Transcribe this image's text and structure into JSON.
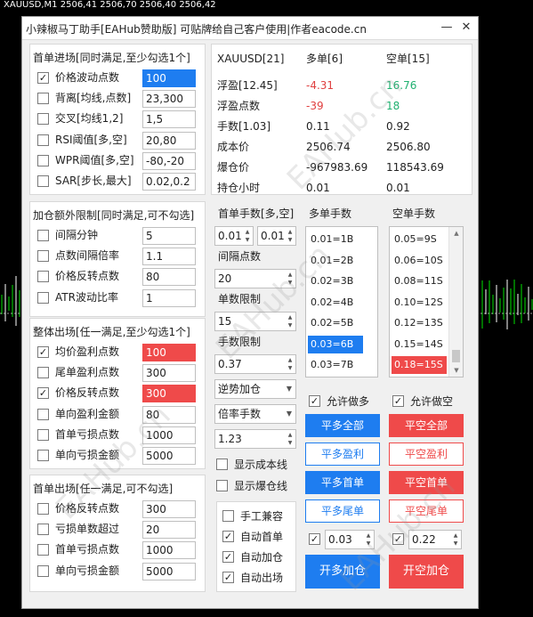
{
  "chart": {
    "header": "XAUUSD,M1  2506,41 2506,70 2506,40 2506,42",
    "bull_color": "#00e000",
    "bear_color": "#ffffff"
  },
  "window": {
    "title": "小辣椒马丁助手[EAHub赞助版]  可贴牌给自己客户使用|作者eacode.cn",
    "minimize": "—",
    "close": "✕"
  },
  "watermark": "EAHub.cn",
  "entry": {
    "title": "首单进场[同时满足,至少勾选1个]",
    "rows": [
      {
        "checked": true,
        "label": "价格波动点数",
        "value": "100",
        "hl": "blue"
      },
      {
        "checked": false,
        "label": "背离[均线,点数]",
        "value": "23,300",
        "hl": ""
      },
      {
        "checked": false,
        "label": "交叉[均线1,2]",
        "value": "1,5",
        "hl": ""
      },
      {
        "checked": false,
        "label": "RSI阈值[多,空]",
        "value": "20,80",
        "hl": ""
      },
      {
        "checked": false,
        "label": "WPR阈值[多,空]",
        "value": "-80,-20",
        "hl": ""
      },
      {
        "checked": false,
        "label": "SAR[步长,最大]",
        "value": "0.02,0.2",
        "hl": ""
      }
    ]
  },
  "addlimit": {
    "title": "加仓额外限制[同时满足,可不勾选]",
    "rows": [
      {
        "checked": false,
        "label": "间隔分钟",
        "value": "5",
        "hl": ""
      },
      {
        "checked": false,
        "label": "点数间隔倍率",
        "value": "1.1",
        "hl": ""
      },
      {
        "checked": false,
        "label": "价格反转点数",
        "value": "80",
        "hl": ""
      },
      {
        "checked": false,
        "label": "ATR波动比率",
        "value": "1",
        "hl": ""
      }
    ]
  },
  "allexit": {
    "title": "整体出场[任一满足,至少勾选1个]",
    "rows": [
      {
        "checked": true,
        "label": "均价盈利点数",
        "value": "100",
        "hl": "red"
      },
      {
        "checked": false,
        "label": "尾单盈利点数",
        "value": "300",
        "hl": ""
      },
      {
        "checked": true,
        "label": "价格反转点数",
        "value": "300",
        "hl": "red"
      },
      {
        "checked": false,
        "label": "单向盈利金额",
        "value": "80",
        "hl": ""
      },
      {
        "checked": false,
        "label": "首单亏损点数",
        "value": "1000",
        "hl": ""
      },
      {
        "checked": false,
        "label": "单向亏损金额",
        "value": "5000",
        "hl": ""
      }
    ]
  },
  "firstexit": {
    "title": "首单出场[任一满足,可不勾选]",
    "rows": [
      {
        "checked": false,
        "label": "价格反转点数",
        "value": "300",
        "hl": ""
      },
      {
        "checked": false,
        "label": "亏损单数超过",
        "value": "20",
        "hl": ""
      },
      {
        "checked": false,
        "label": "首单亏损点数",
        "value": "1000",
        "hl": ""
      },
      {
        "checked": false,
        "label": "单向亏损金额",
        "value": "5000",
        "hl": ""
      }
    ]
  },
  "stats": {
    "headers": [
      "XAUUSD[21]",
      "多单[6]",
      "空单[15]"
    ],
    "rows": [
      {
        "label": "浮盈[12.45]",
        "long": "-4.31",
        "short": "16.76",
        "lc": "#e04040",
        "sc": "#20b070"
      },
      {
        "label": "浮盈点数",
        "long": "-39",
        "short": "18",
        "lc": "#e04040",
        "sc": "#20b070"
      },
      {
        "label": "手数[1.03]",
        "long": "0.11",
        "short": "0.92",
        "lc": "#222222",
        "sc": "#222222"
      },
      {
        "label": "成本价",
        "long": "2506.74",
        "short": "2506.80",
        "lc": "#222222",
        "sc": "#222222"
      },
      {
        "label": "爆仓价",
        "long": "-967983.69",
        "short": "118543.69",
        "lc": "#222222",
        "sc": "#222222"
      },
      {
        "label": "持仓小时",
        "long": "0.01",
        "short": "0.01",
        "lc": "#222222",
        "sc": "#222222"
      }
    ]
  },
  "lots": {
    "first_label": "首单手数[多,空]",
    "first_long": "0.01",
    "first_short": "0.01",
    "interval_label": "间隔点数",
    "interval": "20",
    "single_label": "单数限制",
    "single": "15",
    "lot_label": "手数限制",
    "lot": "0.37",
    "mode": "逆势加仓",
    "lotmode": "倍率手数",
    "multiplier": "1.23",
    "show_cost": "显示成本线",
    "show_blowup": "显示爆仓线"
  },
  "long_lots": {
    "title": "多单手数",
    "items": [
      "0.01=1B",
      "0.01=2B",
      "0.02=3B",
      "0.02=4B",
      "0.02=5B",
      "0.03=6B",
      "0.03=7B"
    ],
    "selected": 5
  },
  "short_lots": {
    "title": "空单手数",
    "items": [
      "0.05=9S",
      "0.06=10S",
      "0.08=11S",
      "0.10=12S",
      "0.12=13S",
      "0.15=14S",
      "0.18=15S"
    ],
    "selected": 6
  },
  "allow": {
    "long": "允许做多",
    "short": "允许做空"
  },
  "buttons": {
    "close_all_long": "平多全部",
    "close_all_short": "平空全部",
    "close_profit_long": "平多盈利",
    "close_profit_short": "平空盈利",
    "close_first_long": "平多首单",
    "close_first_short": "平空首单",
    "close_last_long": "平多尾单",
    "close_last_short": "平空尾单",
    "add_long": "开多加仓",
    "add_short": "开空加仓",
    "add_long_lot": "0.03",
    "add_short_lot": "0.22"
  },
  "modes": {
    "manual": "手工兼容",
    "auto_first": "自动首单",
    "auto_add": "自动加仓",
    "auto_exit": "自动出场"
  }
}
